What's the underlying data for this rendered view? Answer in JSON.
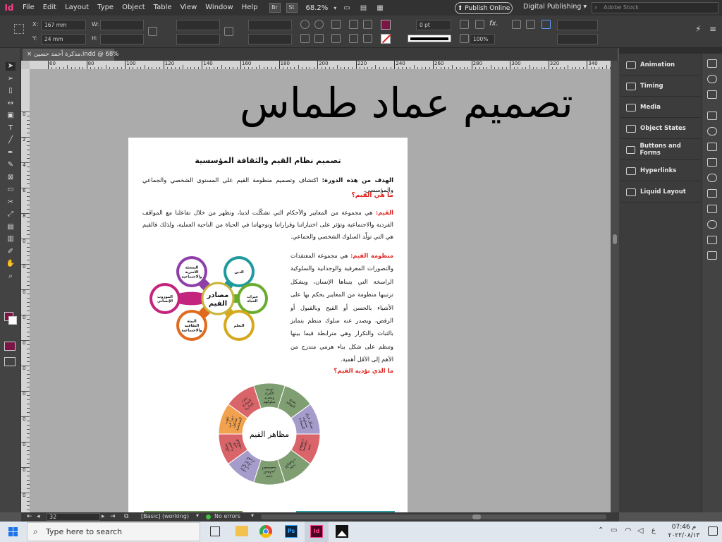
{
  "app": {
    "logo": "Id",
    "zoom": "68.2%"
  },
  "menu": [
    "File",
    "Edit",
    "Layout",
    "Type",
    "Object",
    "Table",
    "View",
    "Window",
    "Help"
  ],
  "menubar_badges": [
    "Br",
    "St"
  ],
  "publish_online": "Publish Online",
  "workspace": "Digital Publishing",
  "stock_search_placeholder": "Adobe Stock",
  "control": {
    "x_label": "X:",
    "x_value": "167 mm",
    "y_label": "Y:",
    "y_value": "24 mm",
    "w_label": "W:",
    "h_label": "H:",
    "stroke_weight": "0 pt",
    "opacity": "100%"
  },
  "document_tab": "مذكرة أحمد حسين.indd @ 68%",
  "ruler_top": [
    "60",
    "80",
    "100",
    "120",
    "140",
    "160",
    "180",
    "200",
    "220",
    "240",
    "260",
    "280",
    "300",
    "320",
    "340"
  ],
  "ruler_left": [
    "0",
    "2",
    "4",
    "6",
    "8",
    "0",
    "0",
    "0",
    "0",
    "0",
    "0",
    "0",
    "0",
    "0",
    "0",
    "0"
  ],
  "watermark": "تصميم عماد طماس",
  "doc": {
    "title": "تصميم نظام القيم والثقافة المؤسسية",
    "goal_label": "الهدف من هذه الدورة:",
    "goal_text": " اكتشاف وتصميم منظومة القيم على المستوى الشخصي والجماعي والمؤسسي.",
    "q1": "ما هي القيم؟",
    "values_label": "القيم:",
    "values_text": " هي مجموعة من المعايير والأحكام التي تشكّلت لدينا، وتظهر من خلال تفاعلنا مع المواقف الفردية والاجتماعية وتؤثر على اختياراتنا وقراراتنا وتوجهاتنا في الحياة من الناحية العملية، ولذلك فالقيم هي التي تولّد السلوك الشخصي والجماعي.",
    "system_label": "منظومة القيم:",
    "system_text": " هي مجموعة المعتقدات والتصورات المعرفية والوجدانية والسلوكية الراسخة التي يتبناها الإنسان، ويشكل ترتيبها منظومة من المعايير يحكم بها على الأشياء بالحسن أو القبح وبالقبول أو الرفض، ويصدر عنه سلوك منظم يتمايز بالثبات والتكرار وهي مترابطة فيما بينها وتنظم على شكل بناء هرمي متدرج من الأهم إلى الأقل أهمية.",
    "q2": "ما الذي تؤديه القيم؟"
  },
  "flower": {
    "center": "مصادر القيم",
    "petals": [
      {
        "label": "التنشئة الأسرية والاجتماعية",
        "color": "#8e3fa8"
      },
      {
        "label": "الدين",
        "color": "#1f9a9e"
      },
      {
        "label": "خبرات الحياة",
        "color": "#6aab2e"
      },
      {
        "label": "التعلم",
        "color": "#d6a91c"
      },
      {
        "label": "البيئة الثقافية والاجتماعية",
        "color": "#e06a1e"
      },
      {
        "label": "الموروث الإنساني",
        "color": "#c2247e"
      }
    ]
  },
  "donut": {
    "center": "مظاهر القيم",
    "segments": [
      {
        "label": "توحيد الأفراد وتحديد سلوكهم",
        "color": "#7f9f72"
      },
      {
        "label": "تصنع الثقافة",
        "color": "#7f9f72"
      },
      {
        "label": "تشكل فرق مستوى السعادة",
        "color": "#a59ccb"
      },
      {
        "label": "تحدد مستوى العلاقات",
        "color": "#d9656a"
      },
      {
        "label": "تحدد الأولويات",
        "color": "#7f9f72"
      },
      {
        "label": "تحدد المعايير الشخصية",
        "color": "#7f9f72"
      },
      {
        "label": "تحدد آليات اتخاذ القرار",
        "color": "#a59ccb"
      },
      {
        "label": "تشكل القدرة على التكيّف",
        "color": "#d9656a"
      },
      {
        "label": "تلعب دوراً في تشكيل الشخصية",
        "color": "#f2a24f"
      },
      {
        "label": "تحدد النماذج الإدارية",
        "color": "#d9656a"
      }
    ]
  },
  "panels": [
    "Animation",
    "Timing",
    "Media",
    "Object States",
    "Buttons and Forms",
    "Hyperlinks",
    "Liquid Layout"
  ],
  "status": {
    "page": "32",
    "style": "[Basic] (working)",
    "errors": "No errors"
  },
  "taskbar": {
    "search": "Type here to search",
    "time": "07:46 م",
    "date": "٢٠٢٢/٠٨/١٣",
    "lang": "ع"
  }
}
